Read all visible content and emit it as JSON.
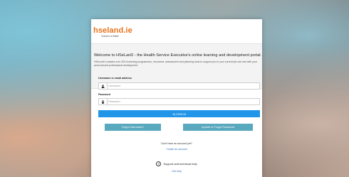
{
  "logo": {
    "name": "hseland.ie",
    "tagline": "Cláraím le Bailte"
  },
  "welcome": {
    "title": "Welcome to HSeLanD - the Health Service Executive's online learning and development portal.",
    "text": "HSeLanD contains over 200 eLearning programmes, resources, assessment and planning tools to support you in your current job role and with your personal and professional development."
  },
  "login": {
    "username_label": "Username or email address",
    "username_placeholder": "Username",
    "password_label": "Password",
    "password_placeholder": "Password",
    "signin_label": "➜] SIGN IN",
    "forgot_username_label": "Forgot Username?",
    "update_password_label": "Update or Forgot Password"
  },
  "account": {
    "prompt": "Don't have an account yet?",
    "create_link": "Create an account"
  },
  "support": {
    "icon_glyph": "?",
    "title": "Support and technical help",
    "link": "Get help"
  },
  "colors": {
    "brand": "#e8731b",
    "primary": "#2196e8",
    "secondary": "#58a8be",
    "link": "#2d6fb7"
  }
}
